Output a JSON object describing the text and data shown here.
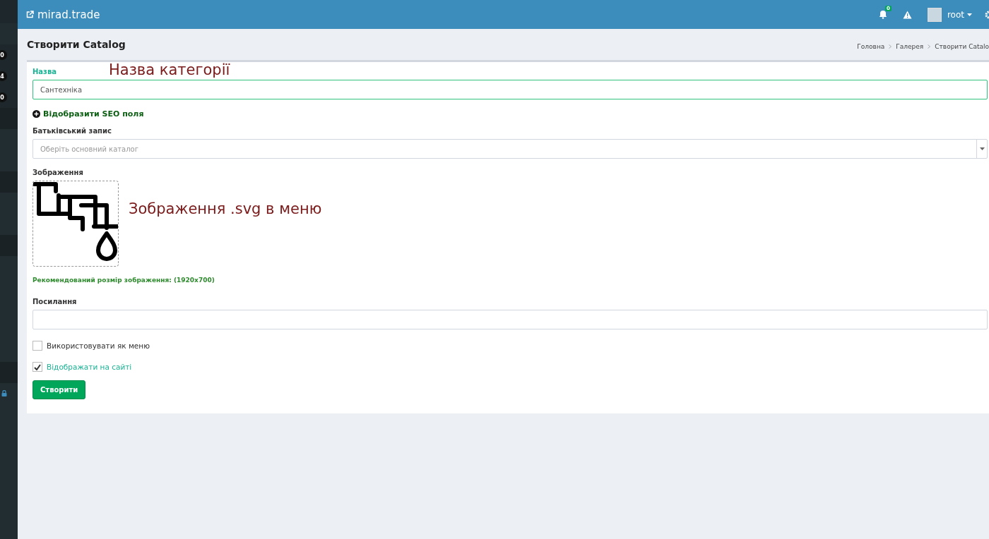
{
  "header": {
    "brand": "mirad.trade",
    "notifications_count": "0",
    "user": "root"
  },
  "sidebar": {
    "badges": [
      "0",
      "4",
      "0"
    ]
  },
  "page": {
    "title": "Створити Catalog",
    "breadcrumbs": [
      "Головна",
      "Галерея",
      "Створити Catalo"
    ]
  },
  "form": {
    "name_label": "Назва",
    "name_value": "Сантехніка",
    "seo_toggle": "Відобразити SEO поля",
    "parent_label": "Батьківський запис",
    "parent_placeholder": "Оберіть основний каталог",
    "image_label": "Зображення",
    "image_hint": "Рекомендований розмір зображення: (1920x700)",
    "link_label": "Посилання",
    "checkboxes": [
      {
        "label": "Використовувати як меню",
        "checked": false
      },
      {
        "label": "Відображати на сайті",
        "checked": true
      }
    ],
    "submit": "Створити"
  },
  "annotations": [
    "Назва категорії",
    "Зображення .svg в меню"
  ]
}
